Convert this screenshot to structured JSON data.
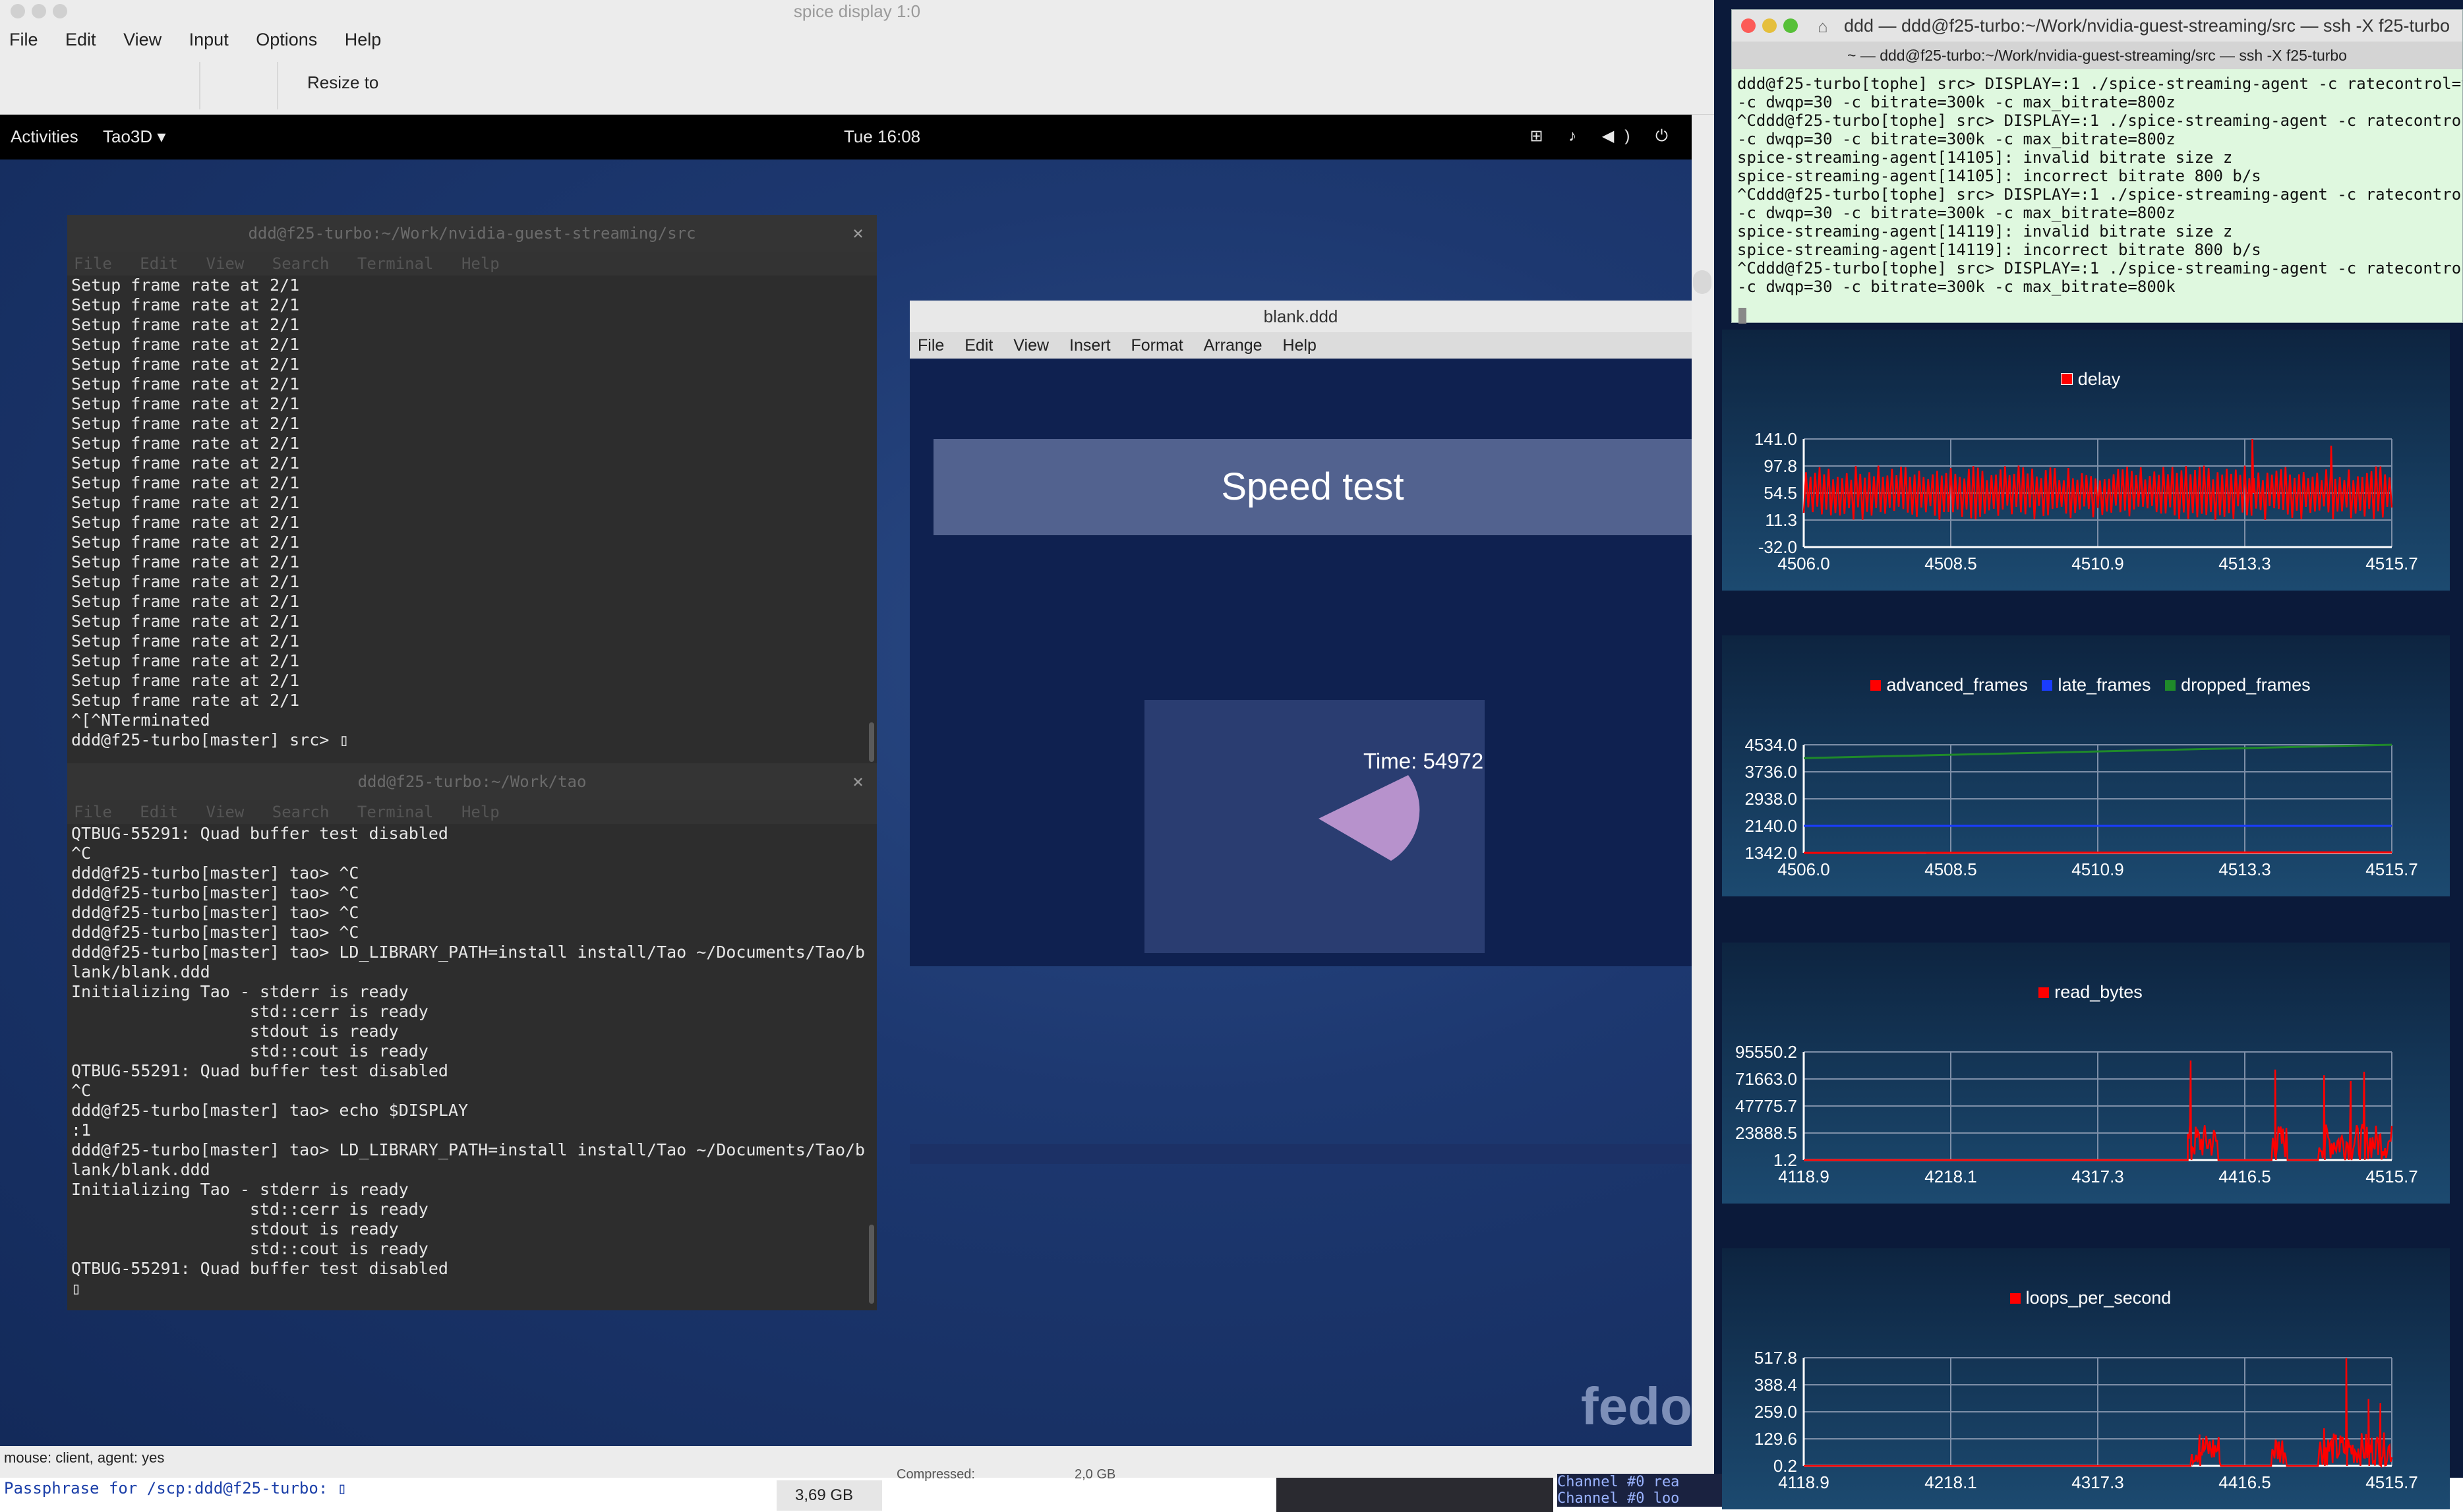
{
  "spice": {
    "window_title": "spice display 1:0",
    "menu": [
      "File",
      "Edit",
      "View",
      "Input",
      "Options",
      "Help"
    ],
    "toolbar": {
      "resize_label": "Resize to"
    },
    "status": "mouse: client, agent: yes"
  },
  "gnome": {
    "activities": "Activities",
    "workspace": "Tao3D ▾",
    "clock": "Tue 16:08",
    "tray": "⊞ ♪ ◀) ⏻",
    "logo": "fedo"
  },
  "term1": {
    "title": "ddd@f25-turbo:~/Work/nvidia-guest-streaming/src",
    "menu": [
      "File",
      "Edit",
      "View",
      "Search",
      "Terminal",
      "Help"
    ],
    "lines": [
      "Setup frame rate at 2/1",
      "Setup frame rate at 2/1",
      "Setup frame rate at 2/1",
      "Setup frame rate at 2/1",
      "Setup frame rate at 2/1",
      "Setup frame rate at 2/1",
      "Setup frame rate at 2/1",
      "Setup frame rate at 2/1",
      "Setup frame rate at 2/1",
      "Setup frame rate at 2/1",
      "Setup frame rate at 2/1",
      "Setup frame rate at 2/1",
      "Setup frame rate at 2/1",
      "Setup frame rate at 2/1",
      "Setup frame rate at 2/1",
      "Setup frame rate at 2/1",
      "Setup frame rate at 2/1",
      "Setup frame rate at 2/1",
      "Setup frame rate at 2/1",
      "Setup frame rate at 2/1",
      "Setup frame rate at 2/1",
      "Setup frame rate at 2/1",
      "^[^NTerminated",
      "ddd@f25-turbo[master] src> ▯"
    ]
  },
  "term2": {
    "title": "ddd@f25-turbo:~/Work/tao",
    "menu": [
      "File",
      "Edit",
      "View",
      "Search",
      "Terminal",
      "Help"
    ],
    "lines": [
      "QTBUG-55291: Quad buffer test disabled",
      "^C",
      "ddd@f25-turbo[master] tao> ^C",
      "ddd@f25-turbo[master] tao> ^C",
      "ddd@f25-turbo[master] tao> ^C",
      "ddd@f25-turbo[master] tao> ^C",
      "ddd@f25-turbo[master] tao> LD_LIBRARY_PATH=install install/Tao ~/Documents/Tao/b",
      "lank/blank.ddd",
      "Initializing Tao - stderr is ready",
      "                  std::cerr is ready",
      "                  stdout is ready",
      "                  std::cout is ready",
      "QTBUG-55291: Quad buffer test disabled",
      "^C",
      "ddd@f25-turbo[master] tao> echo $DISPLAY",
      ":1",
      "ddd@f25-turbo[master] tao> LD_LIBRARY_PATH=install install/Tao ~/Documents/Tao/b",
      "lank/blank.ddd",
      "Initializing Tao - stderr is ready",
      "                  std::cerr is ready",
      "                  stdout is ready",
      "                  std::cout is ready",
      "QTBUG-55291: Quad buffer test disabled",
      "▯"
    ]
  },
  "tao": {
    "title": "blank.ddd",
    "menu": [
      "File",
      "Edit",
      "View",
      "Insert",
      "Format",
      "Arrange",
      "Help"
    ],
    "speed_title": "Speed test",
    "time_label": "Time: 54972"
  },
  "bottom": {
    "passphrase": "Passphrase for /scp:ddd@f25-turbo: ▯",
    "disk_size": "3,69 GB",
    "compressed": "Compressed:",
    "comp_size": "2,0 GB",
    "channel_text": "Channel #0 rea\nChannel #0 loo"
  },
  "ssh": {
    "title": "ddd — ddd@f25-turbo:~/Work/nvidia-guest-streaming/src — ssh -X f25-turbo",
    "tab": "~ — ddd@f25-turbo:~/Work/nvidia-guest-streaming/src — ssh -X f25-turbo",
    "lines": [
      "ddd@f25-turbo[tophe] src> DISPLAY=:1 ./spice-streaming-agent -c ratecontrol=vbr",
      "-c dwqp=30 -c bitrate=300k -c max_bitrate=800z",
      "^Cddd@f25-turbo[tophe] src> DISPLAY=:1 ./spice-streaming-agent -c ratecontrol=v",
      "-c dwqp=30 -c bitrate=300k -c max_bitrate=800z",
      "spice-streaming-agent[14105]: invalid bitrate size z",
      "spice-streaming-agent[14105]: incorrect bitrate 800 b/s",
      "^Cddd@f25-turbo[tophe] src> DISPLAY=:1 ./spice-streaming-agent -c ratecontrol=v",
      "-c dwqp=30 -c bitrate=300k -c max_bitrate=800z",
      "spice-streaming-agent[14119]: invalid bitrate size z",
      "spice-streaming-agent[14119]: incorrect bitrate 800 b/s",
      "^Cddd@f25-turbo[tophe] src> DISPLAY=:1 ./spice-streaming-agent -c ratecontrol=v",
      "-c dwqp=30 -c bitrate=300k -c max_bitrate=800k"
    ]
  },
  "chart_data": [
    {
      "type": "line",
      "series": [
        {
          "name": "delay",
          "color": "#ff0000",
          "style": "noisy",
          "base": 54.5,
          "amp": 40,
          "spikes": [
            [
              4513.4,
              141.0
            ],
            [
              4514.7,
              130.0
            ]
          ]
        }
      ],
      "x_ticks": [
        "4506.0",
        "4508.5",
        "4510.9",
        "4513.3",
        "4515.7"
      ],
      "y_ticks": [
        "141.0",
        "97.8",
        "54.5",
        "11.3",
        "-32.0"
      ],
      "xlim": [
        4506.0,
        4515.7
      ],
      "ylim": [
        -32.0,
        141.0
      ]
    },
    {
      "type": "line",
      "series": [
        {
          "name": "advanced_frames",
          "color": "#ff0000",
          "style": "flat",
          "x": [
            4506.0,
            4515.7
          ],
          "y": [
            1342.0,
            1360.0
          ]
        },
        {
          "name": "late_frames",
          "color": "#1a3cff",
          "style": "flat",
          "x": [
            4506.0,
            4515.7
          ],
          "y": [
            2140.0,
            2140.0
          ]
        },
        {
          "name": "dropped_frames",
          "color": "#1f8a2a",
          "style": "flat",
          "x": [
            4506.0,
            4515.7
          ],
          "y": [
            4140.0,
            4534.0
          ]
        }
      ],
      "x_ticks": [
        "4506.0",
        "4508.5",
        "4510.9",
        "4513.3",
        "4515.7"
      ],
      "y_ticks": [
        "4534.0",
        "3736.0",
        "2938.0",
        "2140.0",
        "1342.0"
      ],
      "xlim": [
        4506.0,
        4515.7
      ],
      "ylim": [
        1342.0,
        4534.0
      ]
    },
    {
      "type": "line",
      "series": [
        {
          "name": "read_bytes",
          "color": "#ff0000",
          "style": "bursty",
          "start": 4378.0,
          "base": 1.2,
          "amp": 20000,
          "spikes": [
            [
              4380.0,
              88000
            ],
            [
              4437.0,
              80000
            ],
            [
              4470.0,
              75000
            ],
            [
              4488.0,
              70000
            ],
            [
              4497.0,
              78000
            ]
          ]
        }
      ],
      "x_ticks": [
        "4118.9",
        "4218.1",
        "4317.3",
        "4416.5",
        "4515.7"
      ],
      "y_ticks": [
        "95550.2",
        "71663.0",
        "47775.7",
        "23888.5",
        "1.2"
      ],
      "xlim": [
        4118.9,
        4515.7
      ],
      "ylim": [
        1.2,
        95550.2
      ]
    },
    {
      "type": "line",
      "series": [
        {
          "name": "loops_per_second",
          "color": "#ff0000",
          "style": "bursty",
          "start": 4380.0,
          "base": 0.2,
          "amp": 100,
          "spikes": [
            [
              4386.0,
              150
            ],
            [
              4470.0,
              180
            ],
            [
              4485.0,
              517.8
            ],
            [
              4500.0,
              320
            ],
            [
              4508.0,
              300
            ]
          ]
        }
      ],
      "x_ticks": [
        "4118.9",
        "4218.1",
        "4317.3",
        "4416.5",
        "4515.7"
      ],
      "y_ticks": [
        "517.8",
        "388.4",
        "259.0",
        "129.6",
        "0.2"
      ],
      "xlim": [
        4118.9,
        4515.7
      ],
      "ylim": [
        0.2,
        517.8
      ]
    }
  ]
}
